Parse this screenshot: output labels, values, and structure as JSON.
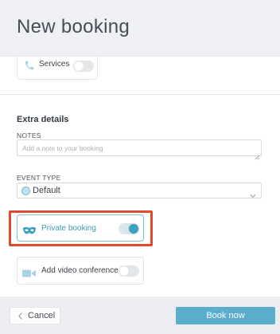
{
  "header": {
    "title": "New booking"
  },
  "services": {
    "label": "Services",
    "icon": "phone-icon",
    "toggle": "off"
  },
  "extra_details": {
    "title": "Extra details",
    "notes_label": "NOTES",
    "notes_placeholder": "Add a note to your booking",
    "notes_value": "",
    "event_type_label": "EVENT TYPE",
    "event_type_value": "Default"
  },
  "private_booking": {
    "label": "Private booking",
    "icon": "mask-icon",
    "toggle": "on"
  },
  "video_conference": {
    "label": "Add video conference",
    "icon": "video-camera-icon",
    "toggle": "off"
  },
  "footer": {
    "cancel_label": "Cancel",
    "book_label": "Book now"
  },
  "colors": {
    "accent": "#3aa3bf",
    "highlight": "#e04a2f",
    "book_button": "#5aaecb"
  }
}
